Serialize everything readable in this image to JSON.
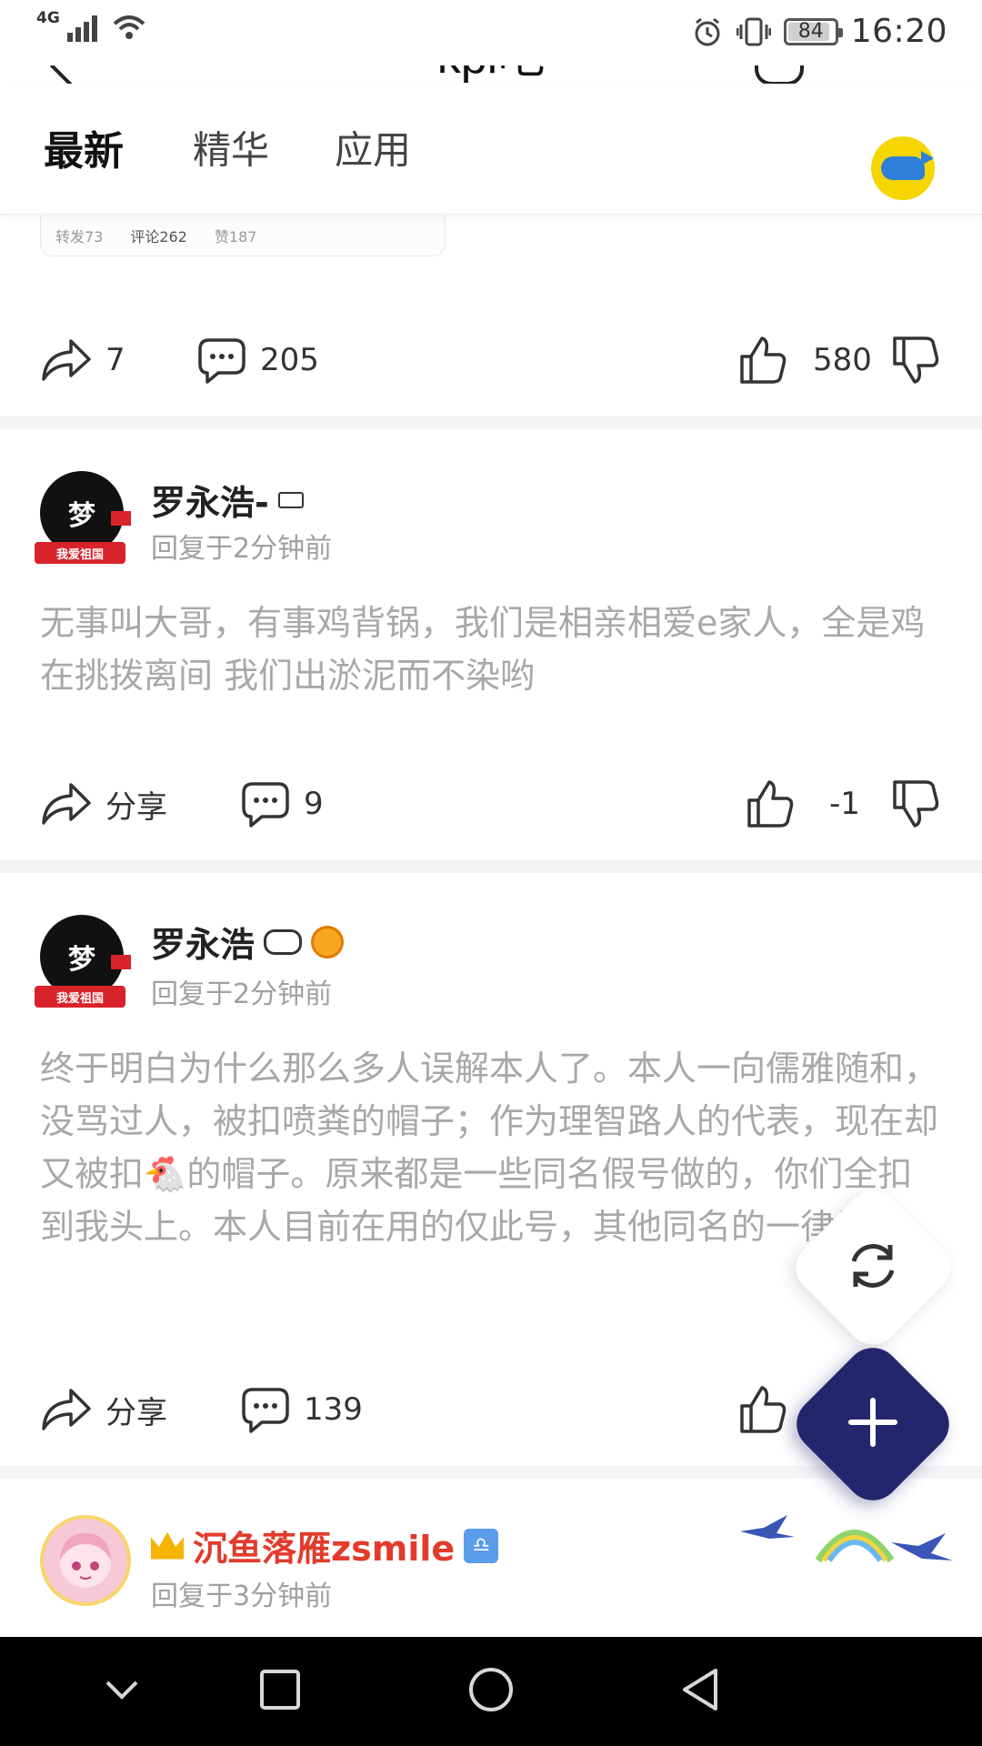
{
  "status_bar": {
    "network": "4G",
    "battery": "84",
    "battery_level": 0.84,
    "time": "16:20"
  },
  "header": {
    "title": "kpl吧"
  },
  "tabs": [
    {
      "label": "最新",
      "active": true
    },
    {
      "label": "精华",
      "active": false
    },
    {
      "label": "应用",
      "active": false
    }
  ],
  "quote_card": {
    "reposts": "转发73",
    "comments": "评论262",
    "likes": "赞187"
  },
  "first_post_actions": {
    "share_count": "7",
    "comment_count": "205",
    "like_count": "580"
  },
  "posts": [
    {
      "username": "罗永浩-",
      "avatar_text": "梦",
      "avatar_ribbon": "我爱祖国",
      "time": "回复于2分钟前",
      "content": "无事叫大哥，有事鸡背锅，我们是相亲相爱e家人，全是鸡在挑拨离间 我们出淤泥而不染哟",
      "share_label": "分享",
      "comment_count": "9",
      "like_count": "-1"
    },
    {
      "username": "罗永浩",
      "avatar_text": "梦",
      "avatar_ribbon": "我爱祖国",
      "time": "回复于2分钟前",
      "content": "终于明白为什么那么多人误解本人了。本人一向儒雅随和，没骂过人，被扣喷粪的帽子；作为理智路人的代表，现在却又被扣🐔的帽子。原来都是一些同名假号做的，你们全扣到我头上。本人目前在用的仅此号，其他同名的一律为假。",
      "share_label": "分享",
      "comment_count": "139"
    },
    {
      "username": "沉鱼落雁zsmile",
      "time": "回复于3分钟前",
      "libra_symbol": "♎"
    }
  ],
  "colors": {
    "accent_tab": "#111111",
    "fab_add": "#24266d",
    "username_vip": "#e23b2b",
    "content_text": "#a8a8a8"
  },
  "icons": {
    "share": "share-arrow-icon",
    "comment": "comment-bubble-icon",
    "like": "thumb-up-icon",
    "dislike": "thumb-down-icon",
    "refresh": "refresh-icon",
    "add": "plus-icon"
  }
}
